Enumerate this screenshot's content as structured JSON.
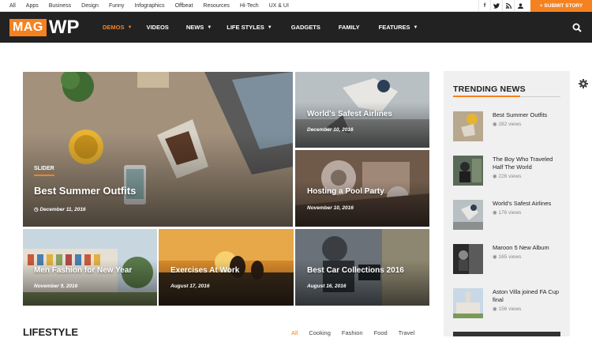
{
  "topbar": {
    "categories": [
      "All",
      "Apps",
      "Business",
      "Design",
      "Funny",
      "Infographics",
      "Offbeat",
      "Resources",
      "Hi-Tech",
      "UX & UI"
    ],
    "social_icons": [
      "facebook-icon",
      "twitter-icon",
      "rss-icon",
      "user-icon"
    ],
    "submit_label": "+ SUBMIT STORY"
  },
  "logo": {
    "mag": "MAG",
    "wp": "WP"
  },
  "nav": {
    "items": [
      {
        "label": "DEMOS",
        "dropdown": true,
        "active": true
      },
      {
        "label": "VIDEOS",
        "dropdown": false
      },
      {
        "label": "NEWS",
        "dropdown": true
      },
      {
        "label": "LIFE STYLES",
        "dropdown": true
      },
      {
        "label": "GADGETS",
        "dropdown": false
      },
      {
        "label": "FAMILY",
        "dropdown": false
      },
      {
        "label": "FEATURES",
        "dropdown": true
      }
    ]
  },
  "featured": {
    "main": {
      "badge": "SLIDER",
      "title": "Best Summer Outfits",
      "date": "December 11, 2016"
    },
    "tiles": [
      {
        "title": "World's Safest Airlines",
        "date": "December 10, 2016"
      },
      {
        "title": "Hosting a Pool Party",
        "date": "November 10, 2016"
      },
      {
        "title": "Men Fashion for New Year",
        "date": "November 9, 2016"
      },
      {
        "title": "Exercises At Work",
        "date": "August 17, 2016"
      },
      {
        "title": "Best Car Collections 2016",
        "date": "August 16, 2016"
      }
    ]
  },
  "trending": {
    "heading": "TRENDING NEWS",
    "items": [
      {
        "title": "Best Summer Outfits",
        "views": "282 views"
      },
      {
        "title": "The Boy Who Traveled Half The World",
        "views": "226 views"
      },
      {
        "title": "World's Safest Airlines",
        "views": "176 views"
      },
      {
        "title": "Maroon 5 New Album",
        "views": "165 views"
      },
      {
        "title": "Aston Villa joined FA Cup final",
        "views": "156 views"
      }
    ]
  },
  "lifestyle": {
    "heading": "LIFESTYLE",
    "filters": [
      "All",
      "Cooking",
      "Fashion",
      "Food",
      "Travel"
    ]
  },
  "colors": {
    "accent": "#f58220",
    "nav_bg": "#222222"
  }
}
